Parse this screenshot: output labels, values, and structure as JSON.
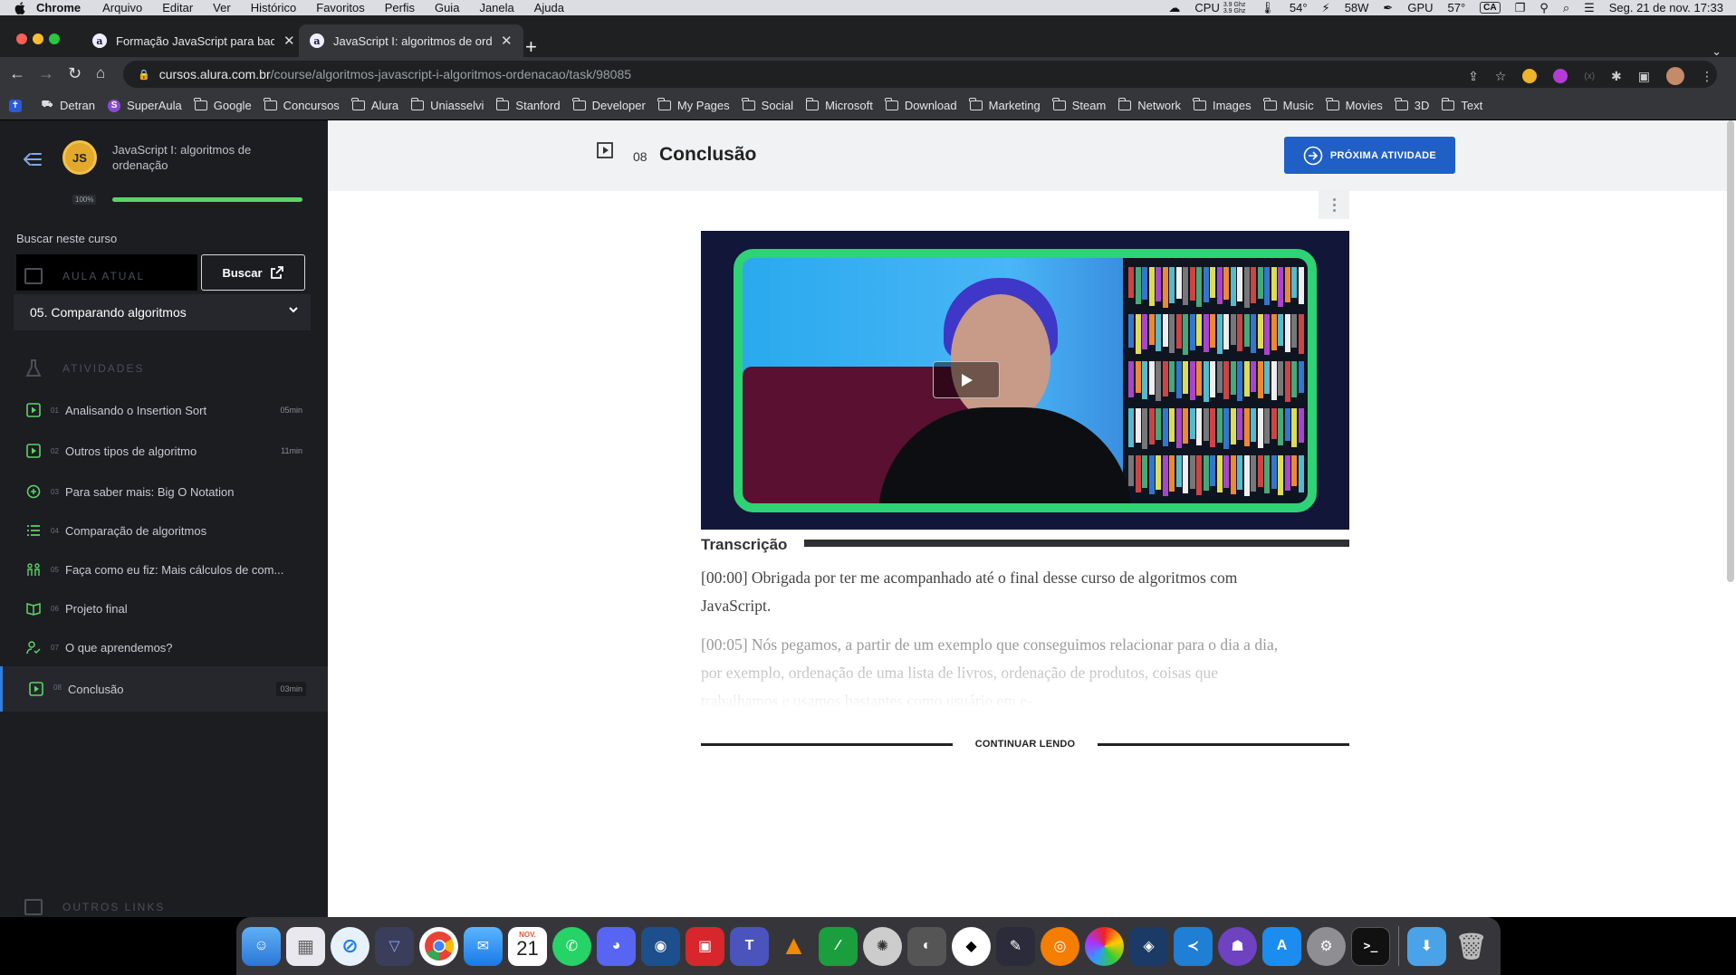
{
  "menubar": {
    "app": "Chrome",
    "items": [
      "Arquivo",
      "Editar",
      "Ver",
      "Histórico",
      "Favoritos",
      "Perfis",
      "Guia",
      "Janela",
      "Ajuda"
    ],
    "cpu_label": "CPU",
    "cpu_freq_1": "3.9 Ghz",
    "cpu_freq_2": "3.9 Ghz",
    "cpu_temp": "54°",
    "power": "58W",
    "gpu_label": "GPU",
    "gpu_temp": "57°",
    "input_source": "CA",
    "datetime": "Seg. 21 de nov.  17:33"
  },
  "tabs": [
    {
      "title": "Formação JavaScript para bac",
      "favicon": "a"
    },
    {
      "title": "JavaScript I: algoritmos de ord",
      "favicon": "a"
    }
  ],
  "address": {
    "host": "cursos.alura.com.br",
    "path": "/course/algoritmos-javascript-i-algoritmos-ordenacao/task/98085"
  },
  "bookmarks": [
    "Detran",
    "SuperAula",
    "Google",
    "Concursos",
    "Alura",
    "Uniasselvi",
    "Stanford",
    "Developer",
    "My Pages",
    "Social",
    "Microsoft",
    "Download",
    "Marketing",
    "Steam",
    "Network",
    "Images",
    "Music",
    "Movies",
    "3D",
    "Text"
  ],
  "sidebar": {
    "course_logo_text": "JS",
    "course_title": "JavaScript I: algoritmos de ordenação",
    "progress_label": "100%",
    "progress_fraction": 1.0,
    "search_label": "Buscar neste curso",
    "search_value": "",
    "search_button": "Buscar",
    "current_lesson_header": "AULA ATUAL",
    "current_lesson": "05. Comparando algoritmos",
    "activities_header": "ATIVIDADES",
    "activities": [
      {
        "num": "01",
        "label": "Analisando o Insertion Sort",
        "duration": "05min",
        "icon": "video-icon"
      },
      {
        "num": "02",
        "label": "Outros tipos de algoritmo",
        "duration": "11min",
        "icon": "video-icon"
      },
      {
        "num": "03",
        "label": "Para saber mais: Big O Notation",
        "duration": "",
        "icon": "plus-circle-icon"
      },
      {
        "num": "04",
        "label": "Comparação de algoritmos",
        "duration": "",
        "icon": "list-icon"
      },
      {
        "num": "05",
        "label": "Faça como eu fiz: Mais cálculos de com...",
        "duration": "",
        "icon": "people-icon"
      },
      {
        "num": "06",
        "label": "Projeto final",
        "duration": "",
        "icon": "book-icon"
      },
      {
        "num": "07",
        "label": "O que aprendemos?",
        "duration": "",
        "icon": "person-check-icon"
      },
      {
        "num": "08",
        "label": "Conclusão",
        "duration": "03min",
        "icon": "video-icon"
      }
    ],
    "other_links_header": "OUTROS LINKS"
  },
  "header": {
    "number": "08",
    "title": "Conclusão",
    "next_button": "PRÓXIMA ATIVIDADE"
  },
  "transcript": {
    "title": "Transcrição",
    "paragraphs": [
      "[00:00] Obrigada por ter me acompanhado até o final desse curso de algoritmos com JavaScript.",
      "[00:05] Nós pegamos, a partir de um exemplo que conseguimos relacionar para o dia a dia, por exemplo, ordenação de uma lista de livros, ordenação de produtos, coisas que trabalhamos e usamos bastantes como usuário em e-"
    ],
    "continue_label": "CONTINUAR LENDO"
  },
  "dock": {
    "calendar_month": "NOV.",
    "calendar_day": "21"
  },
  "colors": {
    "sidebar_bg": "#1c1d21",
    "accent_blue": "#1f5fc6",
    "progress_green": "#5cd36a",
    "video_border_green": "#2fd274"
  }
}
